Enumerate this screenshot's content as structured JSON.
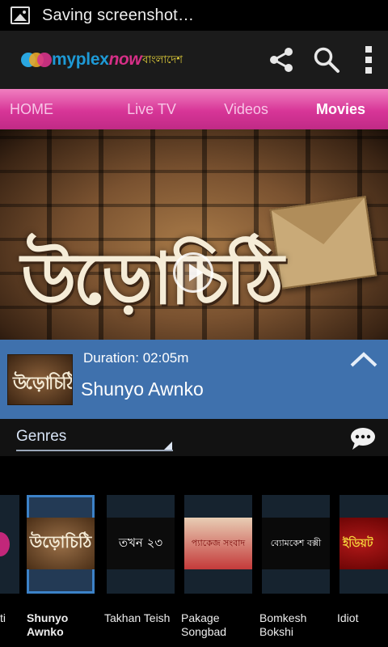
{
  "status_bar": {
    "notification_icon": "image-icon",
    "text": "Saving screenshot…"
  },
  "app_bar": {
    "logo": {
      "part1": "myplex",
      "part2": "now",
      "part3": "বাংলাদেশ"
    },
    "actions": [
      "share-icon",
      "search-icon",
      "overflow-menu-icon"
    ]
  },
  "tabs": [
    {
      "label": "HOME",
      "active": false
    },
    {
      "label": "Live TV",
      "active": false
    },
    {
      "label": "Videos",
      "active": false
    },
    {
      "label": "Movies",
      "active": true
    }
  ],
  "hero": {
    "art_title": "উড়োচিঠি",
    "play_icon": "play-icon"
  },
  "now_playing": {
    "thumb_text": "উড়োচিঠি",
    "duration": "Duration: 02:05m",
    "title": "Shunyo Awnko",
    "collapse_icon": "chevron-up-icon"
  },
  "genres": {
    "label": "Genres",
    "chat_icon": "chat-bubble-icon"
  },
  "carousel": {
    "items": [
      {
        "name": "ti",
        "thumb_text": ""
      },
      {
        "name": "Shunyo Awnko",
        "thumb_text": "উড়োচিঠি",
        "selected": true
      },
      {
        "name": "Takhan Teish",
        "thumb_text": "তখন ২৩"
      },
      {
        "name": "Pakage Songbad",
        "thumb_text": "প্যাকেজ সংবাদ"
      },
      {
        "name": "Bomkesh Bokshi",
        "thumb_text": "ব্যোমকেশ বক্সী"
      },
      {
        "name": "Idiot",
        "thumb_text": "ইডিয়ট"
      }
    ]
  },
  "colors": {
    "tab_bar": "#d73597",
    "info_panel": "#3f71ad",
    "selected_border": "#3c82c8"
  }
}
